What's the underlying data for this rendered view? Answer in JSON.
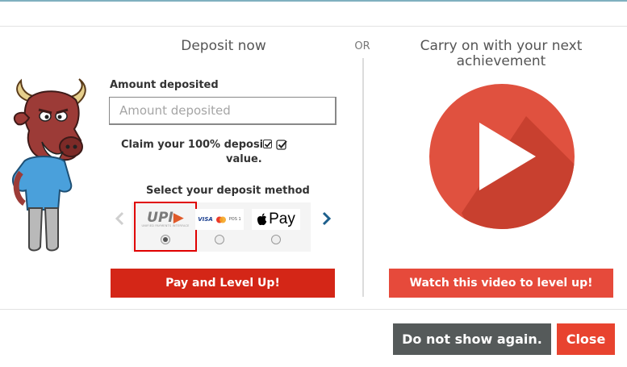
{
  "deposit": {
    "title": "Deposit now",
    "amount_label": "Amount deposited",
    "amount_placeholder": "Amount deposited",
    "amount_value": "",
    "claim_line1": "Claim your 100% deposit",
    "claim_line2": "value.",
    "claim_checked": true,
    "method_label": "Select your deposit method",
    "methods": [
      {
        "name": "UPI",
        "logo_text": "UPI",
        "logo_subtext": "UNIFIED PAYMENTS INTERFACE",
        "selected": true
      },
      {
        "name": "Cards",
        "logo_text": "VISA",
        "logo_subtext": "POS 1",
        "selected": false
      },
      {
        "name": "Apple Pay",
        "logo_text": "Pay",
        "selected": false
      }
    ],
    "pay_button": "Pay and Level Up!"
  },
  "or_label": "OR",
  "video": {
    "title": "Carry on with your next achievement",
    "watch_button": "Watch this video to level up!"
  },
  "footer": {
    "no_show_button": "Do not show again.",
    "close_button": "Close"
  },
  "colors": {
    "pay_red": "#d42617",
    "watch_red": "#e64a3b",
    "play_red": "#e0513f",
    "gray_button": "#555a5a",
    "close_red": "#e8432f",
    "selected_outline": "#e00000"
  },
  "icons": {
    "mascot": "bull-mascot",
    "play": "play-icon",
    "prev": "chevron-left-icon",
    "next": "chevron-right-icon"
  }
}
